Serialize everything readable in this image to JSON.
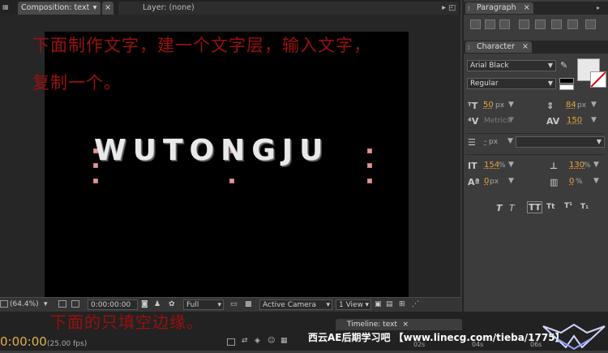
{
  "tabs": {
    "composition": "Composition: text",
    "layer": "Layer: (none)"
  },
  "overlay": {
    "line1": "下面制作文字，建一个文字层，输入文字，",
    "line2": "复制一个。",
    "line3": "下面的只填空边缘。"
  },
  "comp_text": "WUTONGJU",
  "comp_toolbar": {
    "zoom": "(64.4%)",
    "time": "0:00:00:00",
    "resolution": "Full",
    "camera": "Active Camera",
    "view": "1 View"
  },
  "timeline": {
    "tab": "Timeline: text",
    "timecode": "0:00:00",
    "fps": "(25.00 fps)",
    "ticks": [
      "02s",
      "04s",
      "06s"
    ]
  },
  "watermark": "西云AE后期学习吧 【www.linecg.com/tieba/1775】",
  "paragraph": {
    "tab": "Paragraph"
  },
  "character": {
    "tab": "Character",
    "font": "Arial Black",
    "style": "Regular",
    "size": "50",
    "size_unit": "px",
    "leading": "84",
    "leading_unit": "px",
    "kerning": "Metrics",
    "tracking": "150",
    "stroke_width": "-",
    "stroke_unit": "px",
    "vscale": "154",
    "hscale": "130",
    "baseline": "0",
    "tsume": "0",
    "pct": "%",
    "px": "px"
  },
  "colors": {
    "accent": "#e6a53a",
    "note": "#9b1010",
    "timecode": "#e2b048"
  }
}
